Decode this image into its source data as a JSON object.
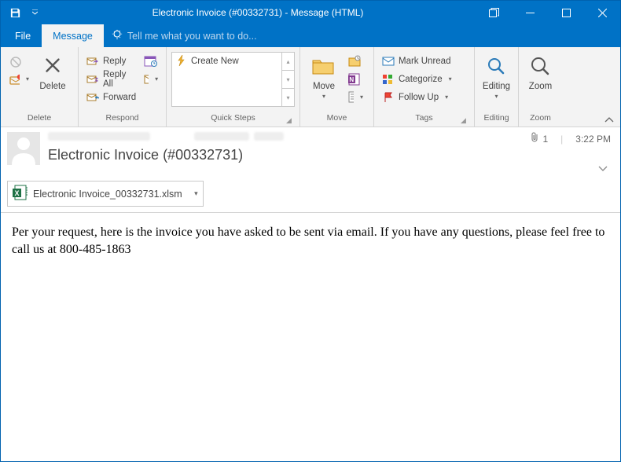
{
  "titlebar": {
    "title": "Electronic Invoice (#00332731) - Message (HTML)"
  },
  "tabs": {
    "file": "File",
    "message": "Message",
    "tellme": "Tell me what you want to do..."
  },
  "ribbon": {
    "delete": {
      "label": "Delete",
      "btn": "Delete"
    },
    "respond": {
      "label": "Respond",
      "reply": "Reply",
      "replyall": "Reply All",
      "forward": "Forward"
    },
    "quicksteps": {
      "label": "Quick Steps",
      "create": "Create New"
    },
    "move": {
      "label": "Move",
      "btn": "Move"
    },
    "tags": {
      "label": "Tags",
      "unread": "Mark Unread",
      "categorize": "Categorize",
      "followup": "Follow Up"
    },
    "editing": {
      "label": "Editing",
      "btn": "Editing"
    },
    "zoom": {
      "label": "Zoom",
      "btn": "Zoom"
    }
  },
  "message": {
    "subject": "Electronic Invoice (#00332731)",
    "attachments_count": "1",
    "received_time": "3:22 PM",
    "attachment_name": "Electronic Invoice_00332731.xlsm",
    "body": "Per your request, here is the invoice you have asked to be sent via email. If you have any questions, please feel free to call us at 800-485-1863"
  }
}
